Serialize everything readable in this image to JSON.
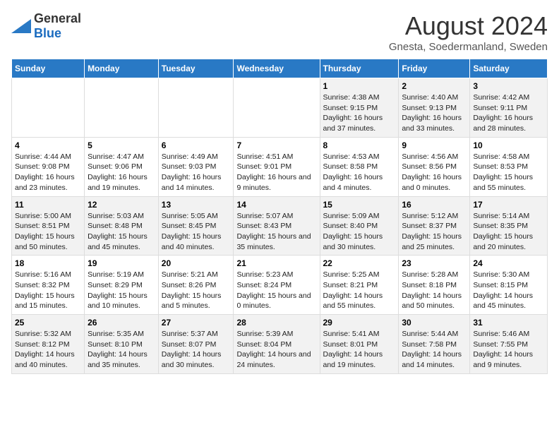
{
  "header": {
    "logo": {
      "general": "General",
      "blue": "Blue"
    },
    "title": "August 2024",
    "subtitle": "Gnesta, Soedermanland, Sweden"
  },
  "days_of_week": [
    "Sunday",
    "Monday",
    "Tuesday",
    "Wednesday",
    "Thursday",
    "Friday",
    "Saturday"
  ],
  "weeks": [
    [
      {
        "day": "",
        "content": ""
      },
      {
        "day": "",
        "content": ""
      },
      {
        "day": "",
        "content": ""
      },
      {
        "day": "",
        "content": ""
      },
      {
        "day": "1",
        "content": "Sunrise: 4:38 AM\nSunset: 9:15 PM\nDaylight: 16 hours\nand 37 minutes."
      },
      {
        "day": "2",
        "content": "Sunrise: 4:40 AM\nSunset: 9:13 PM\nDaylight: 16 hours\nand 33 minutes."
      },
      {
        "day": "3",
        "content": "Sunrise: 4:42 AM\nSunset: 9:11 PM\nDaylight: 16 hours\nand 28 minutes."
      }
    ],
    [
      {
        "day": "4",
        "content": "Sunrise: 4:44 AM\nSunset: 9:08 PM\nDaylight: 16 hours\nand 23 minutes."
      },
      {
        "day": "5",
        "content": "Sunrise: 4:47 AM\nSunset: 9:06 PM\nDaylight: 16 hours\nand 19 minutes."
      },
      {
        "day": "6",
        "content": "Sunrise: 4:49 AM\nSunset: 9:03 PM\nDaylight: 16 hours\nand 14 minutes."
      },
      {
        "day": "7",
        "content": "Sunrise: 4:51 AM\nSunset: 9:01 PM\nDaylight: 16 hours\nand 9 minutes."
      },
      {
        "day": "8",
        "content": "Sunrise: 4:53 AM\nSunset: 8:58 PM\nDaylight: 16 hours\nand 4 minutes."
      },
      {
        "day": "9",
        "content": "Sunrise: 4:56 AM\nSunset: 8:56 PM\nDaylight: 16 hours\nand 0 minutes."
      },
      {
        "day": "10",
        "content": "Sunrise: 4:58 AM\nSunset: 8:53 PM\nDaylight: 15 hours\nand 55 minutes."
      }
    ],
    [
      {
        "day": "11",
        "content": "Sunrise: 5:00 AM\nSunset: 8:51 PM\nDaylight: 15 hours\nand 50 minutes."
      },
      {
        "day": "12",
        "content": "Sunrise: 5:03 AM\nSunset: 8:48 PM\nDaylight: 15 hours\nand 45 minutes."
      },
      {
        "day": "13",
        "content": "Sunrise: 5:05 AM\nSunset: 8:45 PM\nDaylight: 15 hours\nand 40 minutes."
      },
      {
        "day": "14",
        "content": "Sunrise: 5:07 AM\nSunset: 8:43 PM\nDaylight: 15 hours\nand 35 minutes."
      },
      {
        "day": "15",
        "content": "Sunrise: 5:09 AM\nSunset: 8:40 PM\nDaylight: 15 hours\nand 30 minutes."
      },
      {
        "day": "16",
        "content": "Sunrise: 5:12 AM\nSunset: 8:37 PM\nDaylight: 15 hours\nand 25 minutes."
      },
      {
        "day": "17",
        "content": "Sunrise: 5:14 AM\nSunset: 8:35 PM\nDaylight: 15 hours\nand 20 minutes."
      }
    ],
    [
      {
        "day": "18",
        "content": "Sunrise: 5:16 AM\nSunset: 8:32 PM\nDaylight: 15 hours\nand 15 minutes."
      },
      {
        "day": "19",
        "content": "Sunrise: 5:19 AM\nSunset: 8:29 PM\nDaylight: 15 hours\nand 10 minutes."
      },
      {
        "day": "20",
        "content": "Sunrise: 5:21 AM\nSunset: 8:26 PM\nDaylight: 15 hours\nand 5 minutes."
      },
      {
        "day": "21",
        "content": "Sunrise: 5:23 AM\nSunset: 8:24 PM\nDaylight: 15 hours\nand 0 minutes."
      },
      {
        "day": "22",
        "content": "Sunrise: 5:25 AM\nSunset: 8:21 PM\nDaylight: 14 hours\nand 55 minutes."
      },
      {
        "day": "23",
        "content": "Sunrise: 5:28 AM\nSunset: 8:18 PM\nDaylight: 14 hours\nand 50 minutes."
      },
      {
        "day": "24",
        "content": "Sunrise: 5:30 AM\nSunset: 8:15 PM\nDaylight: 14 hours\nand 45 minutes."
      }
    ],
    [
      {
        "day": "25",
        "content": "Sunrise: 5:32 AM\nSunset: 8:12 PM\nDaylight: 14 hours\nand 40 minutes."
      },
      {
        "day": "26",
        "content": "Sunrise: 5:35 AM\nSunset: 8:10 PM\nDaylight: 14 hours\nand 35 minutes."
      },
      {
        "day": "27",
        "content": "Sunrise: 5:37 AM\nSunset: 8:07 PM\nDaylight: 14 hours\nand 30 minutes."
      },
      {
        "day": "28",
        "content": "Sunrise: 5:39 AM\nSunset: 8:04 PM\nDaylight: 14 hours\nand 24 minutes."
      },
      {
        "day": "29",
        "content": "Sunrise: 5:41 AM\nSunset: 8:01 PM\nDaylight: 14 hours\nand 19 minutes."
      },
      {
        "day": "30",
        "content": "Sunrise: 5:44 AM\nSunset: 7:58 PM\nDaylight: 14 hours\nand 14 minutes."
      },
      {
        "day": "31",
        "content": "Sunrise: 5:46 AM\nSunset: 7:55 PM\nDaylight: 14 hours\nand 9 minutes."
      }
    ]
  ]
}
